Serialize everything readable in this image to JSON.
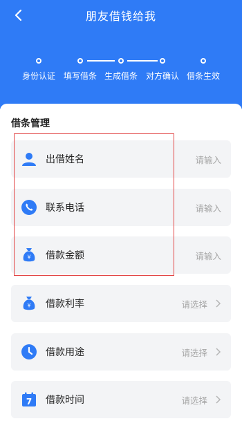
{
  "header": {
    "title": "朋友借钱给我",
    "back_icon": "chevron-left-icon"
  },
  "steps": [
    {
      "label": "身份认证"
    },
    {
      "label": "填写借条"
    },
    {
      "label": "生成借条"
    },
    {
      "label": "对方确认"
    },
    {
      "label": "借条生效"
    }
  ],
  "section": {
    "title": "借条管理"
  },
  "rows": [
    {
      "label": "出借姓名",
      "value": "请输入",
      "icon": "person-icon"
    },
    {
      "label": "联系电话",
      "value": "请输入",
      "icon": "phone-icon"
    },
    {
      "label": "借款金额",
      "value": "请输入",
      "icon": "money-bag-icon"
    },
    {
      "label": "借款利率",
      "value": "请选择",
      "icon": "money-bag-icon"
    },
    {
      "label": "借款用途",
      "value": "请选择",
      "icon": "clock-icon"
    },
    {
      "label": "借款时间",
      "value": "请选择",
      "icon": "calendar-icon"
    }
  ],
  "colors": {
    "brand": "#2f7bf6",
    "highlight_border": "#e24646"
  }
}
